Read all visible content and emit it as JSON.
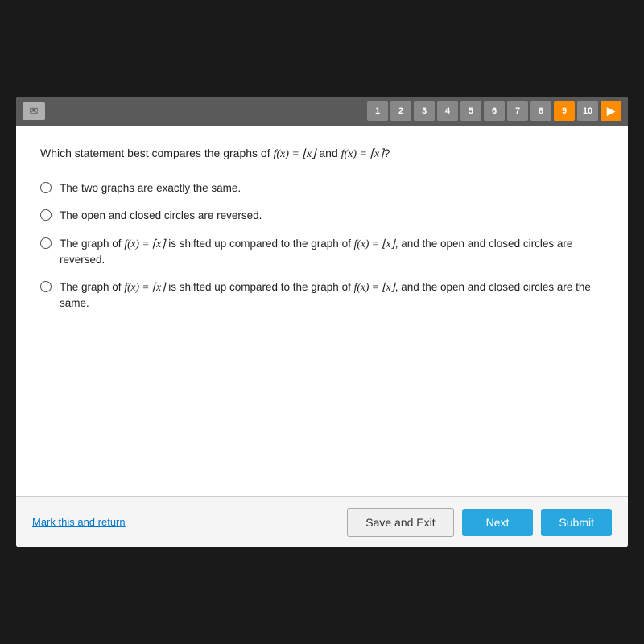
{
  "topbar": {
    "mail_icon": "✉",
    "nav_numbers": [
      "1",
      "2",
      "3",
      "4",
      "5",
      "6",
      "7",
      "8",
      "9",
      "10"
    ],
    "active_index": 8,
    "next_arrow": "▶"
  },
  "question": {
    "text_before": "Which statement best compares the graphs of ",
    "func1": "f(x) = ⌊x⌋",
    "text_mid": " and ",
    "func2": "f(x) = ⌈x⌉",
    "text_after": "?"
  },
  "options": [
    {
      "id": "opt1",
      "text": "The two graphs are exactly the same."
    },
    {
      "id": "opt2",
      "text": "The open and closed circles are reversed."
    },
    {
      "id": "opt3",
      "text_parts": [
        "The graph of ",
        "f(x) = ⌈x⌉",
        " is shifted up compared to the graph of ",
        "f(x) = ⌊x⌋",
        ", and the open and closed circles are reversed."
      ]
    },
    {
      "id": "opt4",
      "text_parts": [
        "The graph of ",
        "f(x) = ⌈x⌉",
        " is shifted up compared to the graph of ",
        "f(x) = ⌊x⌋",
        ", and the open and closed circles are the same."
      ]
    }
  ],
  "footer": {
    "mark_label": "Mark this and return",
    "save_label": "Save and Exit",
    "next_label": "Next",
    "submit_label": "Submit"
  }
}
